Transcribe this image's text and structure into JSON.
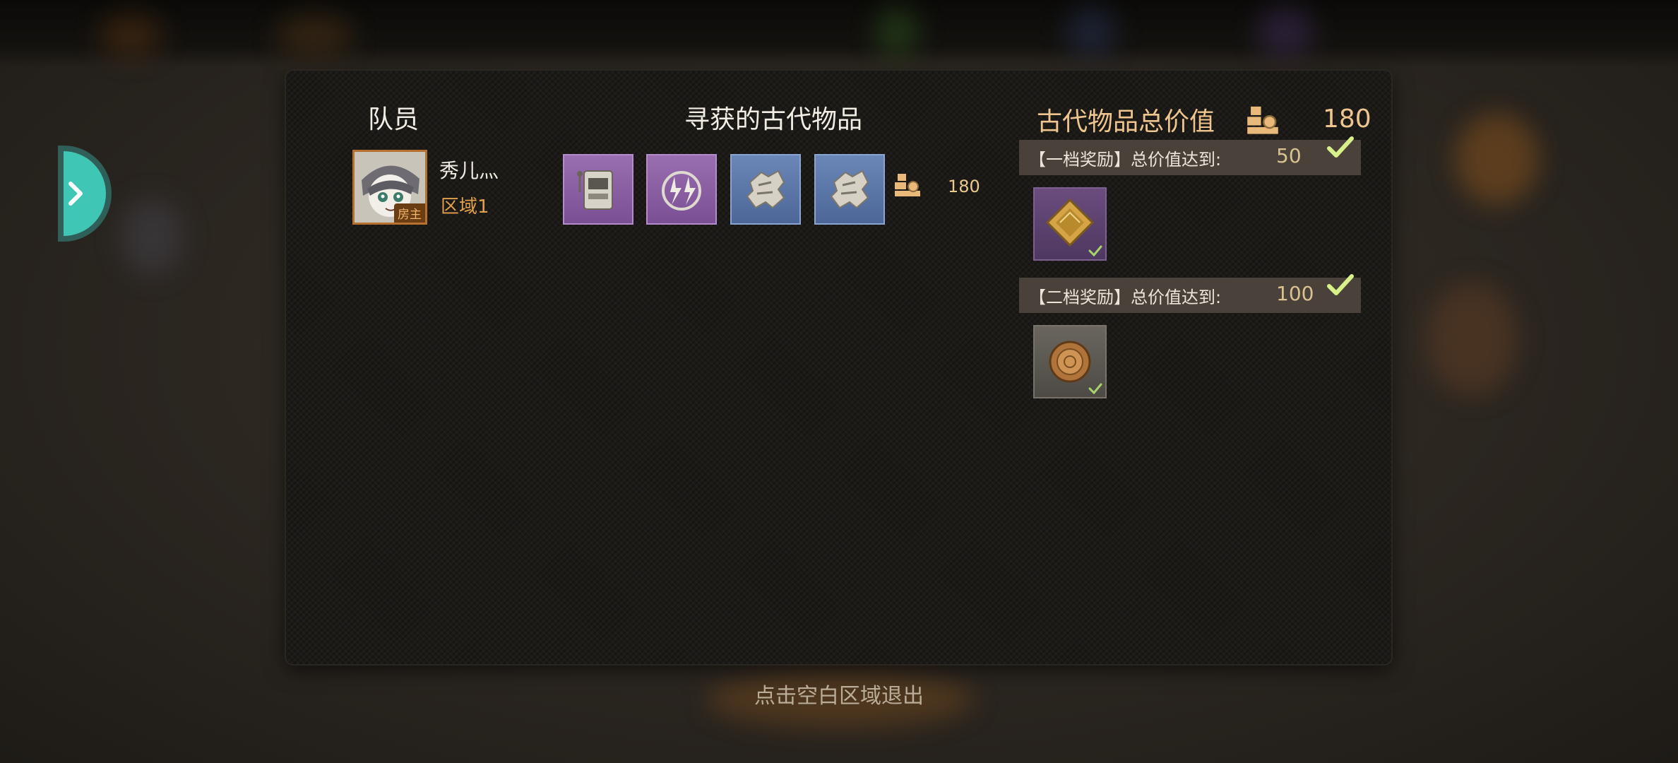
{
  "members": {
    "header": "队员",
    "list": [
      {
        "name": "秀儿灬",
        "zone": "区域1",
        "badge": "房主"
      }
    ]
  },
  "found_items": {
    "header": "寻获的古代物品",
    "items": [
      {
        "icon": "slot-machine-icon",
        "rarity": "purple"
      },
      {
        "icon": "lightning-icon",
        "rarity": "purple"
      },
      {
        "icon": "gear-fragment-icon",
        "rarity": "blue"
      },
      {
        "icon": "gear-fragment-icon",
        "rarity": "blue"
      }
    ],
    "value": "180",
    "value_icon": "coin-stack-icon"
  },
  "total": {
    "title": "古代物品总价值",
    "value": "180",
    "icon": "coin-stack-icon"
  },
  "tiers": [
    {
      "label": "【一档奖励】总价值达到:",
      "threshold": "50",
      "achieved": true,
      "reward_icon": "diamond-gem-icon"
    },
    {
      "label": "【二档奖励】总价值达到:",
      "threshold": "100",
      "achieved": true,
      "reward_icon": "bronze-coin-icon"
    }
  ],
  "exit_hint": "点击空白区域退出",
  "colors": {
    "accent_gold": "#efc58f",
    "teal_tab": "#3fc6b4",
    "check_green": "#d8f08a",
    "zone_orange": "#e2a04a"
  }
}
